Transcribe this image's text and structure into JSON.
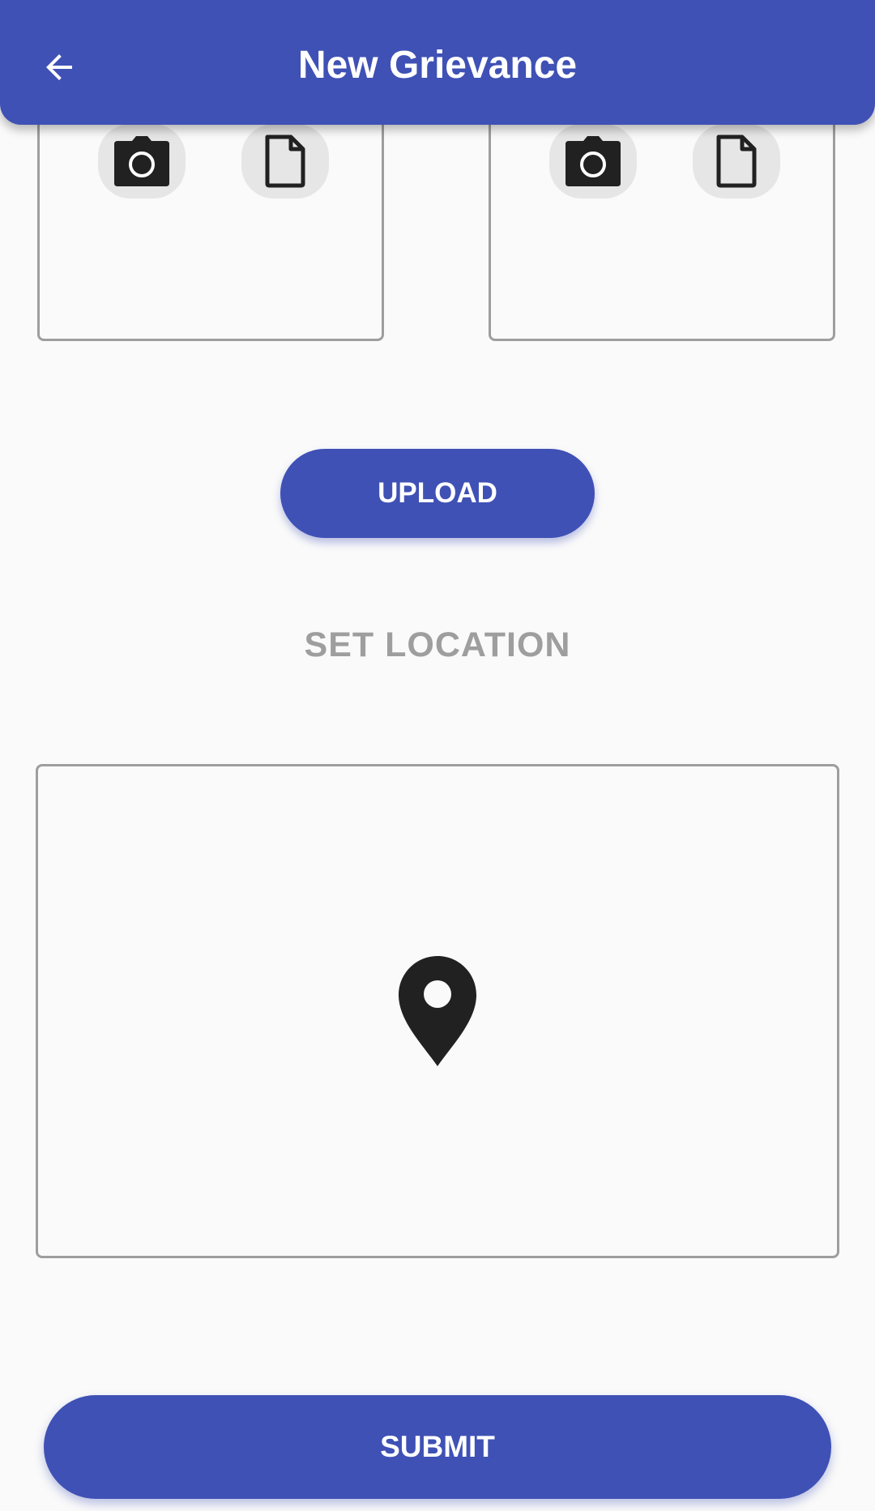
{
  "appbar": {
    "title": "New Grievance",
    "back_icon": "arrow-left-icon"
  },
  "attachments": {
    "cards": [
      {
        "camera_icon": "camera-icon",
        "file_icon": "document-icon"
      },
      {
        "camera_icon": "camera-icon",
        "file_icon": "document-icon"
      }
    ]
  },
  "upload": {
    "label": "UPLOAD"
  },
  "location": {
    "title": "SET LOCATION",
    "pin_icon": "location-pin-icon"
  },
  "submit": {
    "label": "SUBMIT"
  },
  "colors": {
    "primary": "#3f51b5",
    "border": "#9e9e9e",
    "muted_text": "#9e9e9e",
    "background": "#fafafa"
  }
}
